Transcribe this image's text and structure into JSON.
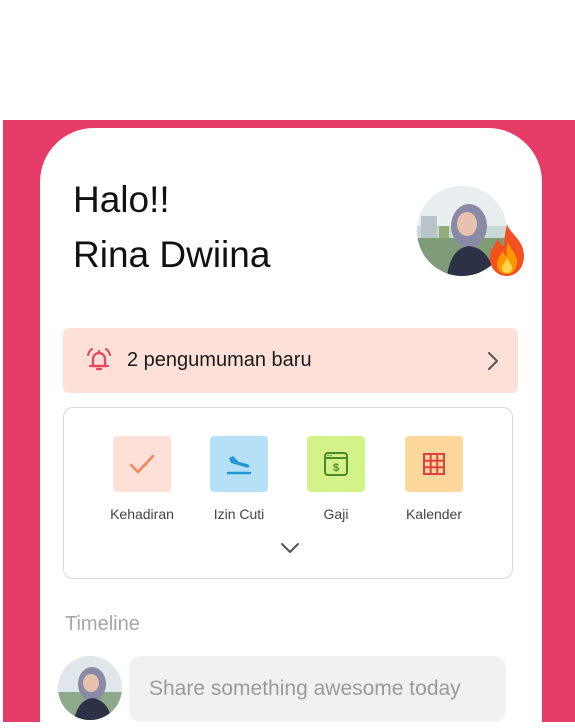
{
  "header": {
    "greeting_line1": "Halo!!",
    "greeting_line2": "Rina Dwiina"
  },
  "announcement": {
    "text": "2 pengumuman baru",
    "icon": "bell-ringing-icon"
  },
  "menu": {
    "items": [
      {
        "label": "Kehadiran",
        "icon": "check-icon",
        "color": "#fde0d8"
      },
      {
        "label": "Izin Cuti",
        "icon": "plane-landing-icon",
        "color": "#b5e0f5"
      },
      {
        "label": "Gaji",
        "icon": "payslip-icon",
        "color": "#d3f28a"
      },
      {
        "label": "Kalender",
        "icon": "calendar-grid-icon",
        "color": "#fdd79b"
      }
    ],
    "expand_icon": "chevron-down-icon"
  },
  "timeline": {
    "label": "Timeline",
    "share_placeholder": "Share something awesome today"
  },
  "colors": {
    "brand": "#e63d68",
    "announcement_bg": "#fde0d8",
    "icon_red": "#e8455f"
  }
}
